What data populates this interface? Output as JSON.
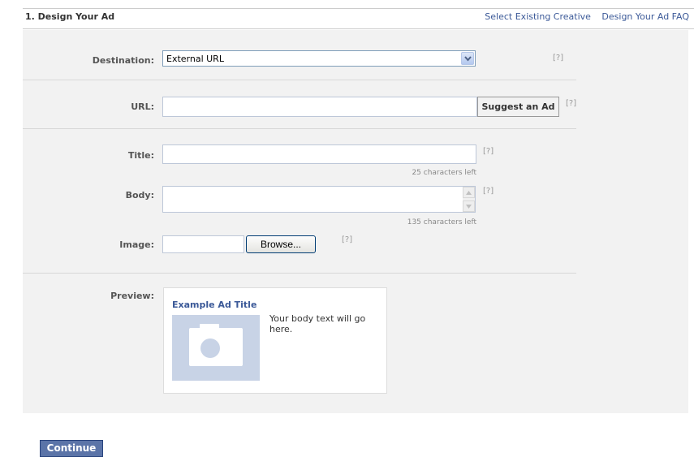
{
  "header": {
    "title": "1. Design Your Ad",
    "links": [
      "Select Existing Creative",
      "Design Your Ad FAQ"
    ]
  },
  "form": {
    "destination": {
      "label": "Destination:",
      "value": "External URL",
      "help": "[?]"
    },
    "url": {
      "label": "URL:",
      "value": "",
      "button": "Suggest an Ad",
      "help": "[?]"
    },
    "title": {
      "label": "Title:",
      "value": "",
      "counter": "25 characters left",
      "help": "[?]"
    },
    "body": {
      "label": "Body:",
      "value": "",
      "counter": "135 characters left",
      "help": "[?]"
    },
    "image": {
      "label": "Image:",
      "value": "",
      "button": "Browse...",
      "help": "[?]"
    },
    "preview": {
      "label": "Preview:",
      "ad_title": "Example Ad Title",
      "ad_body": "Your body text will go here."
    }
  },
  "footer": {
    "continue_label": "Continue"
  },
  "icons": [
    "dropdown-arrow-icon",
    "scroll-up-arrow-icon",
    "scroll-down-arrow-icon",
    "camera-icon"
  ],
  "colors": {
    "link": "#3b5998",
    "button": "#5b74a8",
    "panel": "#f2f2f2"
  }
}
